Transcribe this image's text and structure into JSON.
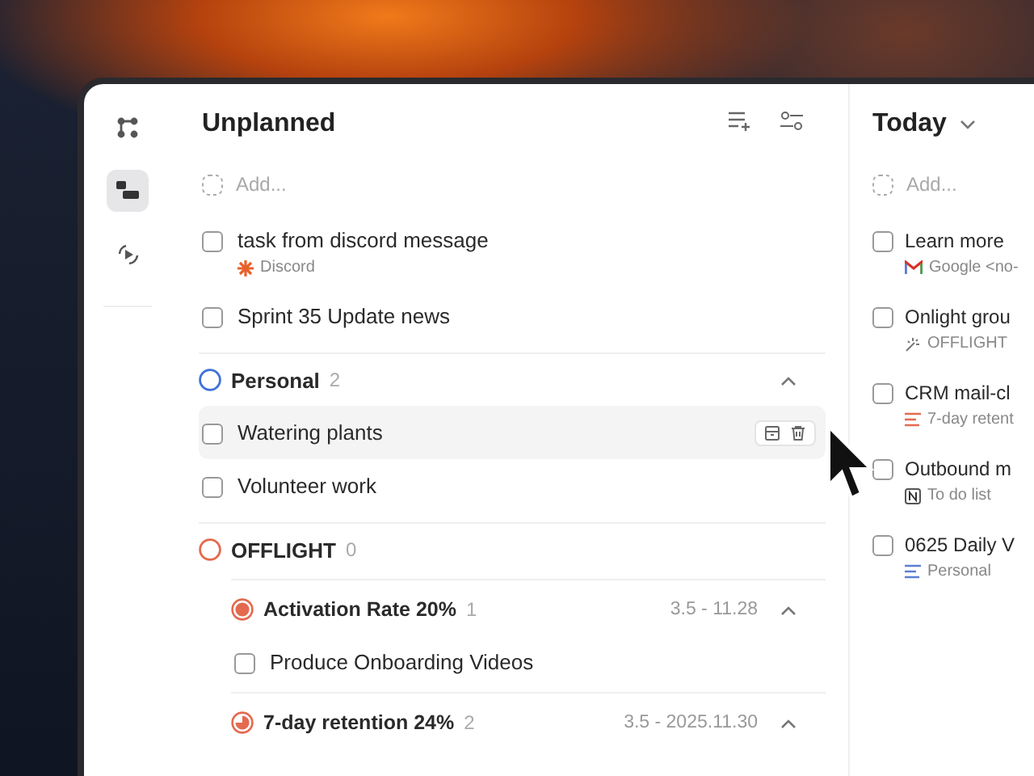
{
  "sidebar": {
    "items": [
      {
        "selected": false
      },
      {
        "selected": true
      },
      {
        "selected": false
      }
    ]
  },
  "unplanned": {
    "title": "Unplanned",
    "add_placeholder": "Add...",
    "tasks": [
      {
        "title": "task from discord message",
        "checked": false,
        "source": {
          "kind": "discord",
          "label": "Discord"
        }
      },
      {
        "title": "Sprint 35 Update news",
        "checked": false
      }
    ],
    "groups": [
      {
        "name": "Personal",
        "count": "2",
        "color": "#3d72d9",
        "expanded": true,
        "tasks": [
          {
            "title": "Watering plants",
            "checked": false,
            "hovered": true
          },
          {
            "title": "Volunteer work",
            "checked": false,
            "hovered": false
          }
        ]
      },
      {
        "name": "OFFLIGHT",
        "count": "0",
        "color": "#e36a4f",
        "subgroups": [
          {
            "name": "Activation Rate 20%",
            "count": "1",
            "kind": "filled",
            "dates": "3.5 - 11.28",
            "expanded": true,
            "tasks": [
              {
                "title": "Produce Onboarding Videos",
                "checked": false
              }
            ]
          },
          {
            "name": "7-day retention 24%",
            "count": "2",
            "kind": "pie",
            "dates": "3.5 - 2025.11.30",
            "expanded": true
          }
        ]
      }
    ]
  },
  "today": {
    "title": "Today",
    "add_placeholder": "Add...",
    "tasks": [
      {
        "title": "Learn more",
        "checked": false,
        "source": {
          "kind": "gmail",
          "label": "Google <no-"
        }
      },
      {
        "title": "Onlight grou",
        "checked": false,
        "source": {
          "kind": "offlight",
          "label": "OFFLIGHT"
        }
      },
      {
        "title": "CRM mail-cl",
        "checked": false,
        "source": {
          "kind": "goal",
          "label": "7-day retent"
        }
      },
      {
        "title": "Outbound m",
        "checked": false,
        "source": {
          "kind": "notion",
          "label": "To do list"
        }
      },
      {
        "title": "0625 Daily V",
        "checked": false,
        "source": {
          "kind": "list",
          "label": "Personal"
        }
      }
    ]
  }
}
